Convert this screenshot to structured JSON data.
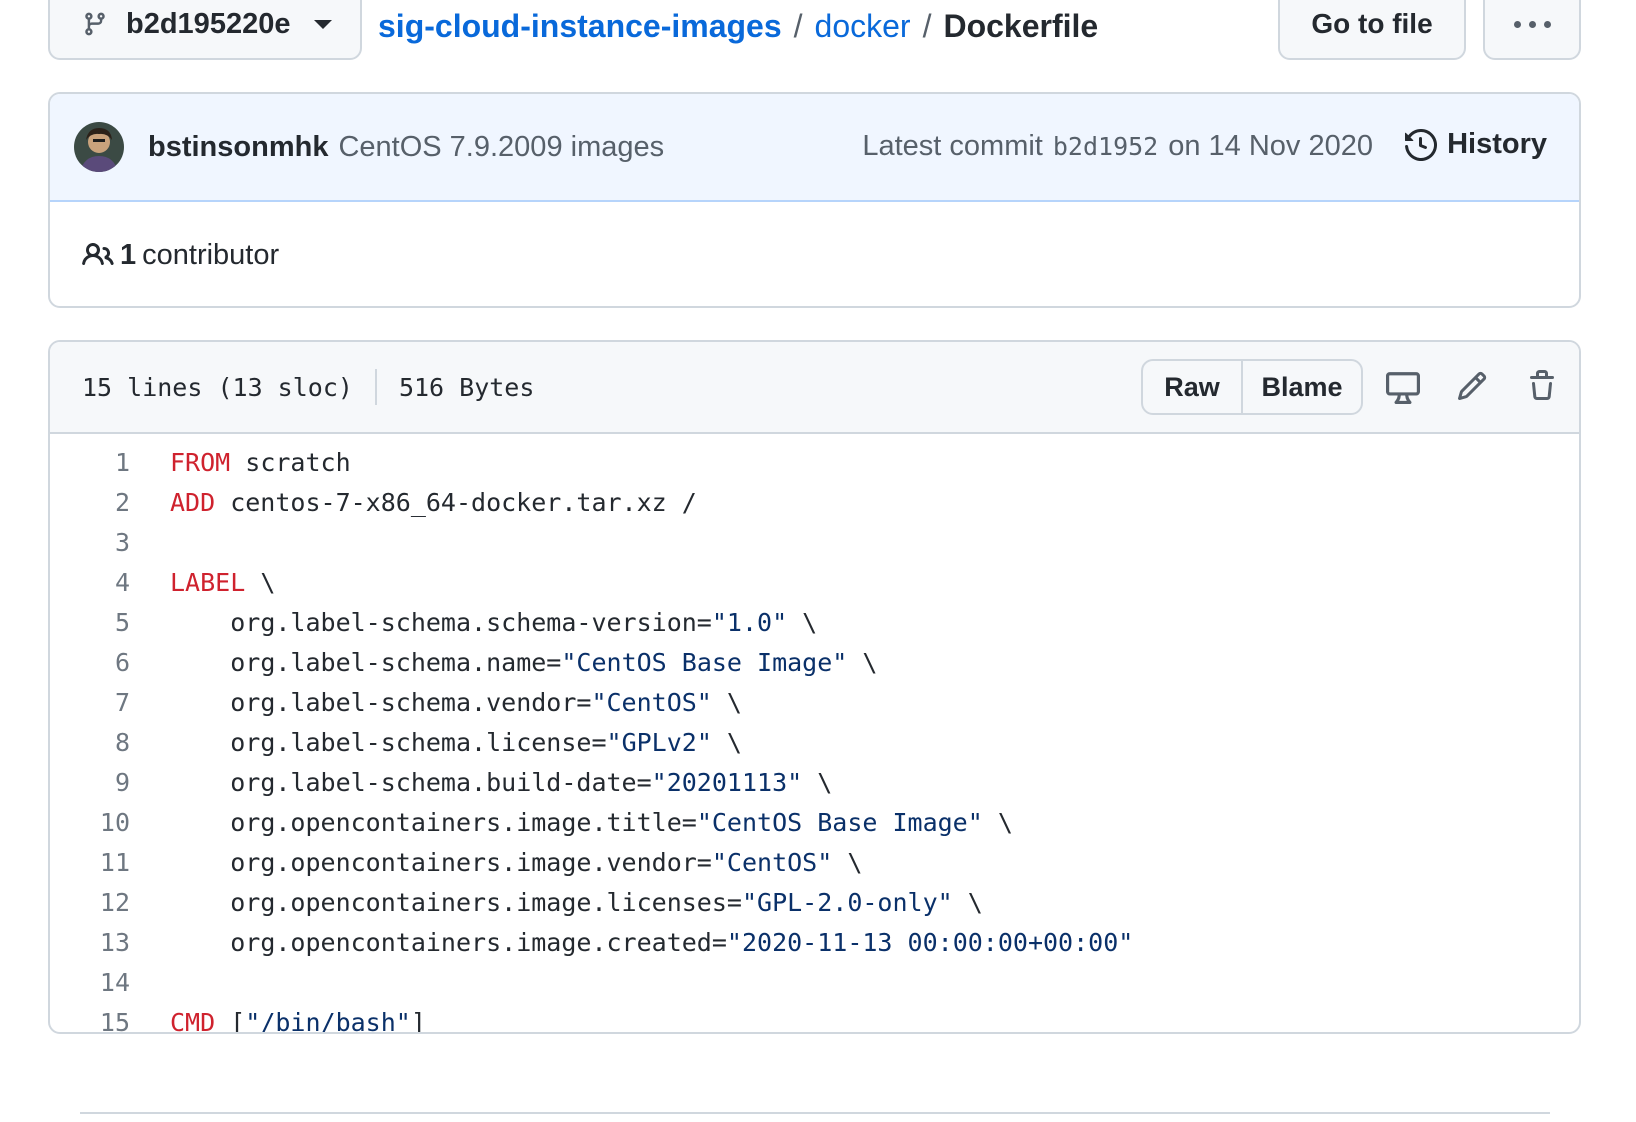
{
  "branch": {
    "name": "b2d195220e"
  },
  "breadcrumb": {
    "repo": "sig-cloud-instance-images",
    "sep": "/",
    "dir": "docker",
    "file": "Dockerfile"
  },
  "toolbar": {
    "goto_label": "Go to file"
  },
  "commit": {
    "author": "bstinsonmhk",
    "message": "CentOS 7.9.2009 images",
    "latest_prefix": "Latest commit",
    "sha": "b2d1952",
    "date": "on 14 Nov 2020",
    "history_label": "History"
  },
  "contributors": {
    "count": "1",
    "label": "contributor"
  },
  "file": {
    "lines_info": "15 lines (13 sloc)",
    "size": "516 Bytes",
    "raw_label": "Raw",
    "blame_label": "Blame",
    "lines": [
      {
        "n": "1",
        "indent": "",
        "kw": "FROM",
        "text": " scratch",
        "str": "",
        "tail": ""
      },
      {
        "n": "2",
        "indent": "",
        "kw": "ADD",
        "text": " centos-7-x86_64-docker.tar.xz /",
        "str": "",
        "tail": ""
      },
      {
        "n": "3",
        "indent": "",
        "kw": "",
        "text": "",
        "str": "",
        "tail": ""
      },
      {
        "n": "4",
        "indent": "",
        "kw": "LABEL",
        "text": " \\",
        "str": "",
        "tail": ""
      },
      {
        "n": "5",
        "indent": "    ",
        "kw": "",
        "text": "org.label-schema.schema-version=",
        "str": "\"1.0\"",
        "tail": " \\"
      },
      {
        "n": "6",
        "indent": "    ",
        "kw": "",
        "text": "org.label-schema.name=",
        "str": "\"CentOS Base Image\"",
        "tail": " \\"
      },
      {
        "n": "7",
        "indent": "    ",
        "kw": "",
        "text": "org.label-schema.vendor=",
        "str": "\"CentOS\"",
        "tail": " \\"
      },
      {
        "n": "8",
        "indent": "    ",
        "kw": "",
        "text": "org.label-schema.license=",
        "str": "\"GPLv2\"",
        "tail": " \\"
      },
      {
        "n": "9",
        "indent": "    ",
        "kw": "",
        "text": "org.label-schema.build-date=",
        "str": "\"20201113\"",
        "tail": " \\"
      },
      {
        "n": "10",
        "indent": "    ",
        "kw": "",
        "text": "org.opencontainers.image.title=",
        "str": "\"CentOS Base Image\"",
        "tail": " \\"
      },
      {
        "n": "11",
        "indent": "    ",
        "kw": "",
        "text": "org.opencontainers.image.vendor=",
        "str": "\"CentOS\"",
        "tail": " \\"
      },
      {
        "n": "12",
        "indent": "    ",
        "kw": "",
        "text": "org.opencontainers.image.licenses=",
        "str": "\"GPL-2.0-only\"",
        "tail": " \\"
      },
      {
        "n": "13",
        "indent": "    ",
        "kw": "",
        "text": "org.opencontainers.image.created=",
        "str": "\"2020-11-13 00:00:00+00:00\"",
        "tail": ""
      },
      {
        "n": "14",
        "indent": "",
        "kw": "",
        "text": "",
        "str": "",
        "tail": ""
      },
      {
        "n": "15",
        "indent": "",
        "kw": "CMD",
        "text": " [",
        "str": "\"/bin/bash\"",
        "tail": "]"
      }
    ]
  },
  "icons": {
    "branch": "git-branch-icon",
    "more": "kebab-horizontal-icon",
    "history": "history-icon",
    "people": "people-icon",
    "desktop": "desktop-icon",
    "edit": "pencil-icon",
    "delete": "trash-icon"
  },
  "colors": {
    "link": "#0969da",
    "keyword": "#cf222e",
    "string": "#0a3069",
    "commit_bg": "#f0f6ff"
  }
}
